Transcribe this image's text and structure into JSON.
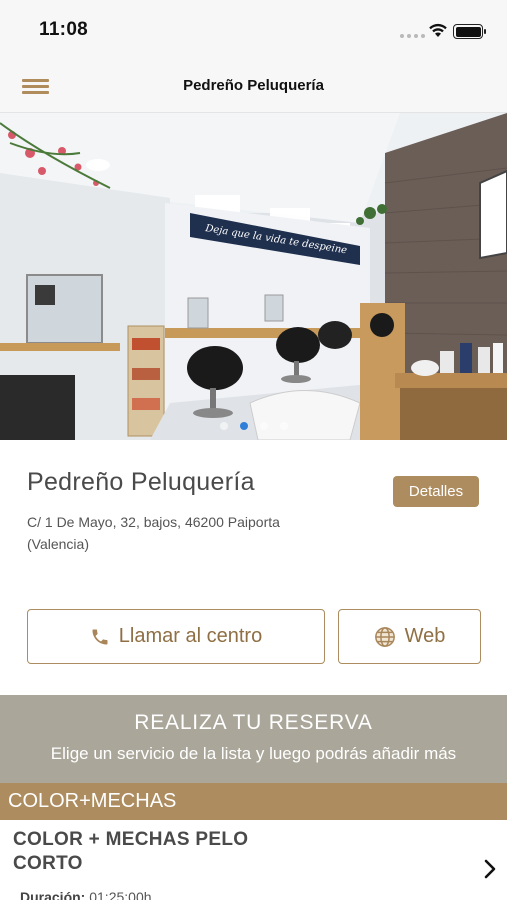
{
  "status_bar": {
    "time": "11:08"
  },
  "nav": {
    "title": "Pedreño Peluquería",
    "menu_icon": "hamburger-icon"
  },
  "hero": {
    "wall_sign": "Deja que la vida te despeine",
    "carousel": {
      "pages": 4,
      "active_index": 1
    }
  },
  "salon": {
    "name": "Pedreño Peluquería",
    "details_label": "Detalles",
    "address": "C/ 1 De Mayo, 32, bajos, 46200 Paiporta (Valencia)"
  },
  "actions": {
    "call_label": "Llamar al centro",
    "call_icon": "phone-icon",
    "web_label": "Web",
    "web_icon": "globe-icon"
  },
  "reservation": {
    "title": "REALIZA TU RESERVA",
    "subtitle": "Elige un servicio de la lista y luego podrás añadir más"
  },
  "category": {
    "name": "COLOR+MECHAS"
  },
  "services": [
    {
      "name": "COLOR + MECHAS PELO CORTO",
      "duration_label": "Duración:",
      "duration": "01:25:00h"
    }
  ],
  "colors": {
    "accent": "#ad8c5f",
    "banner": "#aaa699",
    "carousel_active": "#2f7fd8"
  }
}
